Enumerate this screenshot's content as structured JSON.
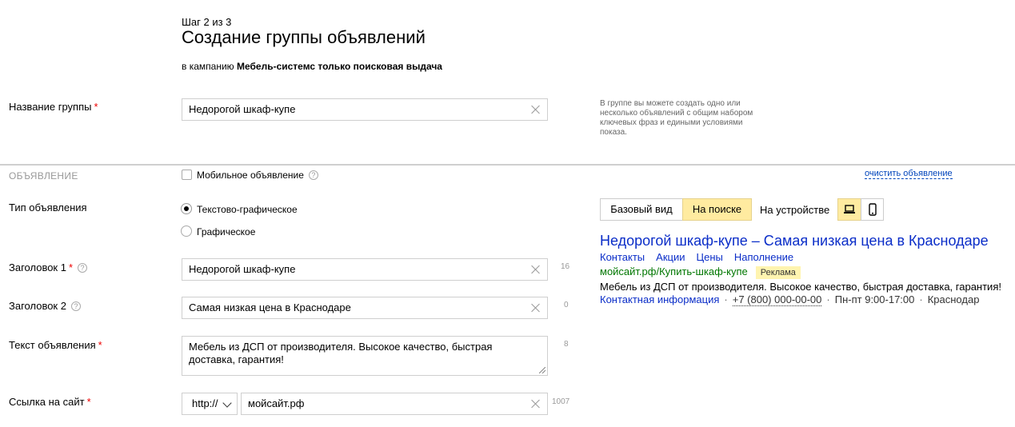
{
  "header": {
    "step": "Шаг 2 из 3",
    "title": "Создание группы объявлений",
    "campaign_prefix": "в кампанию ",
    "campaign_name": "Мебель-системс только поисковая выдача"
  },
  "group": {
    "label": "Название группы",
    "value": "Недорогой шкаф-купе",
    "hint": "В группе вы можете создать одно или несколько объявлений с общим набором ключевых фраз и едиными условиями показа."
  },
  "ad_section": {
    "title": "ОБЪЯВЛЕНИЕ",
    "mobile_label": "Мобильное объявление",
    "clear_link": "очистить объявление"
  },
  "ad_type": {
    "label": "Тип объявления",
    "options": [
      "Текстово-графическое",
      "Графическое"
    ],
    "selected": "Текстово-графическое"
  },
  "preview_controls": {
    "basic": "Базовый вид",
    "on_search": "На поиске",
    "on_device": "На устройстве"
  },
  "headline1": {
    "label": "Заголовок 1",
    "value": "Недорогой шкаф-купе",
    "counter": "16"
  },
  "headline2": {
    "label": "Заголовок 2",
    "value": "Самая низкая цена в Краснодаре",
    "counter": "0"
  },
  "ad_text": {
    "label": "Текст объявления",
    "value": "Мебель из ДСП от производителя. Высокое качество, быстрая доставка, гарантия!",
    "counter": "8"
  },
  "site_link": {
    "label": "Ссылка на сайт",
    "protocol": "http://",
    "value": "мойсайт.рф",
    "counter": "1007"
  },
  "preview": {
    "title": "Недорогой шкаф-купе – Самая низкая цена в Краснодаре",
    "sitelinks": [
      "Контакты",
      "Акции",
      "Цены",
      "Наполнение"
    ],
    "url": "мойсайт.рф/Купить-шкаф-купе",
    "badge": "Реклама",
    "text": "Мебель из ДСП от производителя. Высокое качество, быстрая доставка, гарантия!",
    "contact_info": "Контактная информация",
    "phone": "+7 (800) 000-00-00",
    "hours": "Пн-пт 9:00-17:00",
    "city": "Краснодар"
  },
  "colors": {
    "link": "#0a2dc8",
    "url": "#007700",
    "active_button": "#ffeba0",
    "required": "#ee0000"
  }
}
